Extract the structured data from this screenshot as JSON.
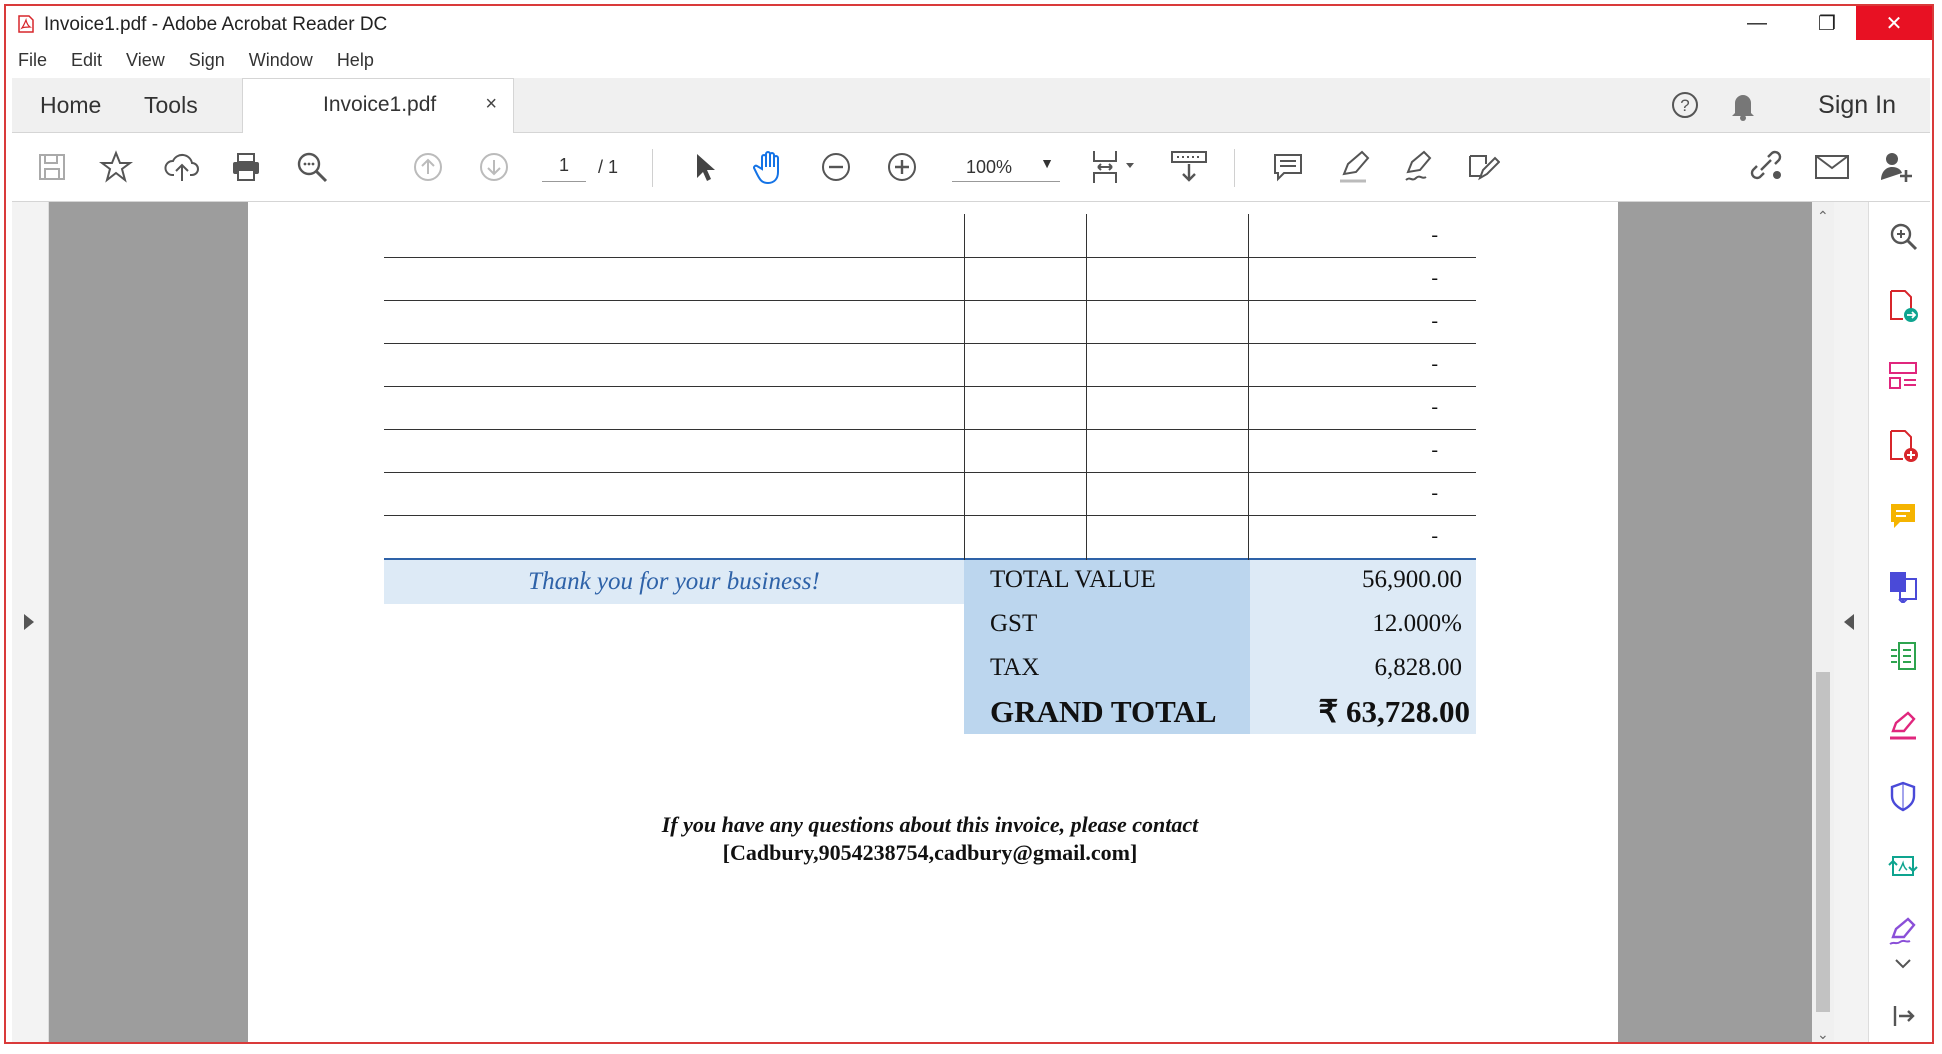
{
  "window": {
    "title": "Invoice1.pdf - Adobe Acrobat Reader DC",
    "min": "—",
    "max": "❐",
    "close": "✕"
  },
  "menu": [
    "File",
    "Edit",
    "View",
    "Sign",
    "Window",
    "Help"
  ],
  "tabs": {
    "home": "Home",
    "tools": "Tools",
    "document": "Invoice1.pdf",
    "close": "×"
  },
  "header": {
    "sign_in": "Sign In"
  },
  "toolbar": {
    "page_current": "1",
    "page_total": "/ 1",
    "zoom": "100%",
    "zoom_caret": "▼"
  },
  "invoice": {
    "blank_rows": [
      "-",
      "-",
      "-",
      "-",
      "-",
      "-",
      "-",
      "-"
    ],
    "thank_you": "Thank you for your business!",
    "totals": [
      {
        "label": "TOTAL VALUE",
        "value": "56,900.00"
      },
      {
        "label": "GST",
        "value": "12.000%"
      },
      {
        "label": "TAX",
        "value": "6,828.00"
      },
      {
        "label": "GRAND TOTAL",
        "value": "₹ 63,728.00"
      }
    ],
    "contact_line1": "If you have any questions about this invoice, please contact",
    "contact_line2": "[Cadbury,9054238754,cadbury@gmail.com]"
  },
  "colors": {
    "accent_red": "#e81123",
    "label_fill": "#bcd6ee",
    "value_fill": "#ddeaf6",
    "thanks_text": "#2e62a8"
  }
}
